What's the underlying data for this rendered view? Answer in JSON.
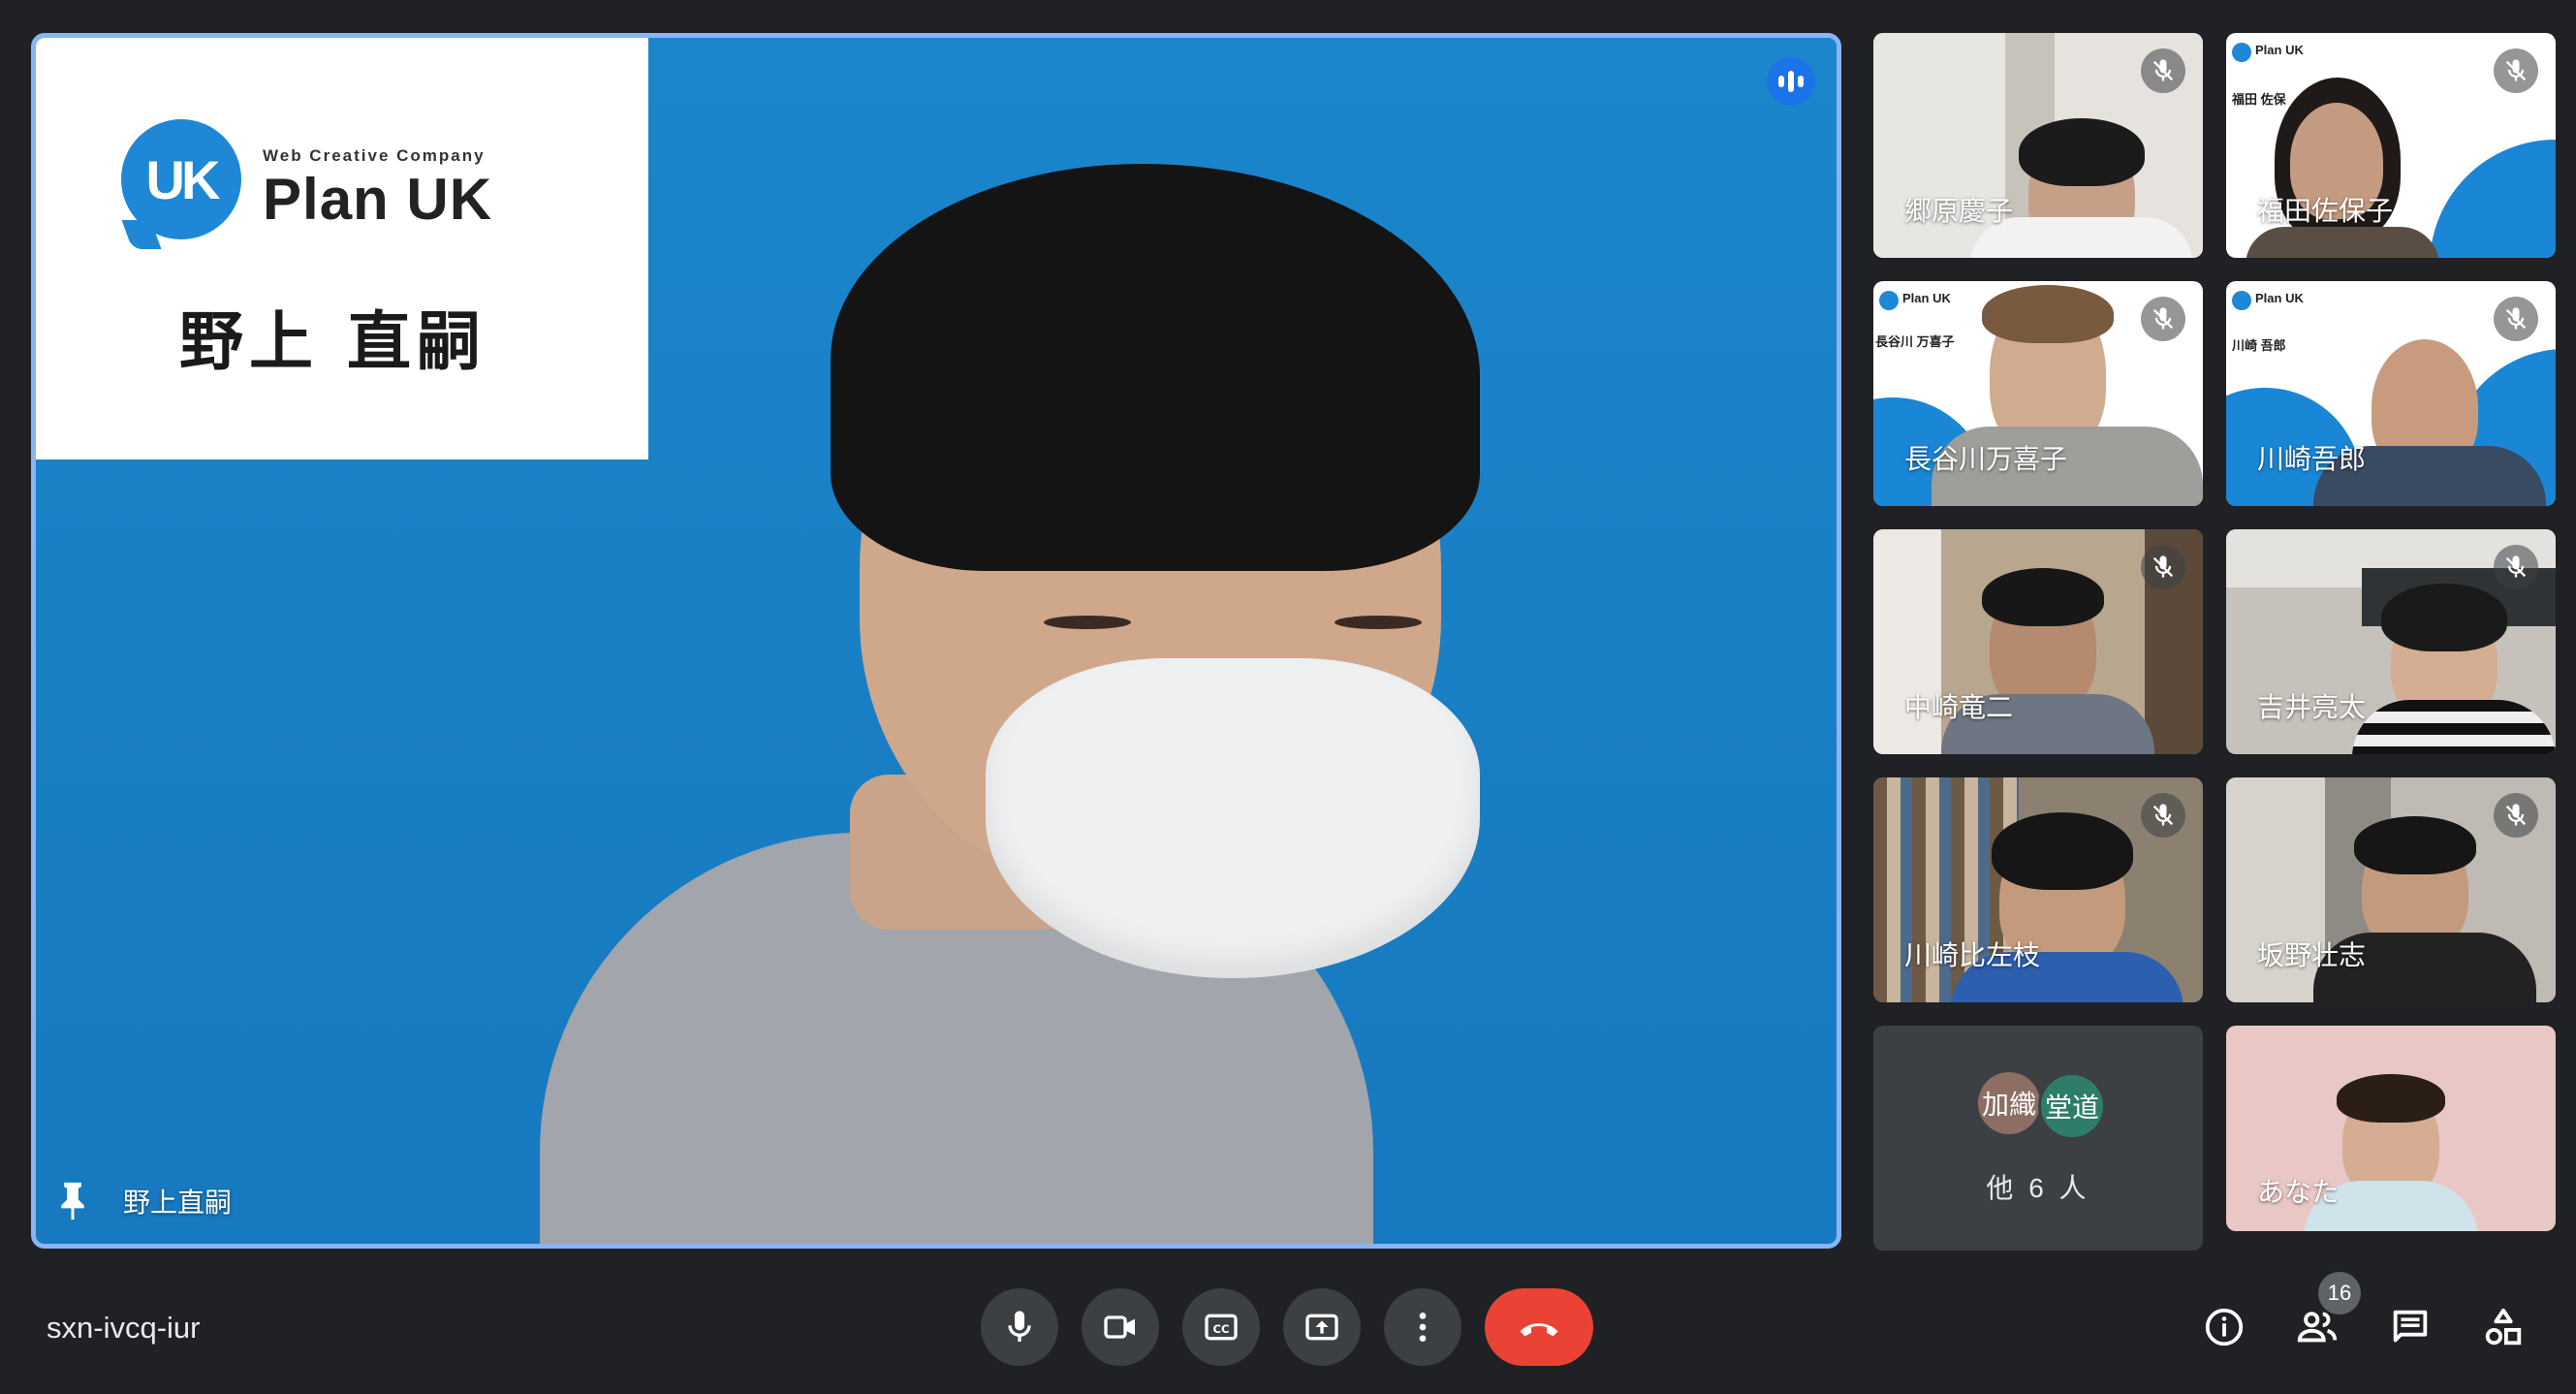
{
  "meeting": {
    "code": "sxn-ivcq-iur"
  },
  "main_speaker": {
    "name": "野上直嗣",
    "card": {
      "tagline": "Web Creative Company",
      "brand": "Plan UK",
      "logo_letters": "UK",
      "person": "野上 直嗣"
    }
  },
  "participants": [
    {
      "name": "郷原慶子",
      "muted": true
    },
    {
      "name": "福田佐保子",
      "muted": true,
      "card_name": "福田 佐保"
    },
    {
      "name": "長谷川万喜子",
      "muted": true,
      "card_name": "長谷川 万喜子"
    },
    {
      "name": "川崎吾郎",
      "muted": true,
      "card_name": "川崎 吾郎"
    },
    {
      "name": "中崎竜二",
      "muted": true
    },
    {
      "name": "吉井亮太",
      "muted": true
    },
    {
      "name": "川崎比左枝",
      "muted": true
    },
    {
      "name": "坂野壮志",
      "muted": true
    }
  ],
  "others": {
    "avatar1": "加織",
    "avatar2": "堂道",
    "label": "他 6 人"
  },
  "self": {
    "name": "あなた"
  },
  "people_count": "16",
  "icons": {
    "mic": "mic-icon",
    "camera": "camera-icon",
    "captions": "captions-icon",
    "present": "present-icon",
    "more": "more-vert-icon",
    "hangup": "call-end-icon",
    "info": "info-icon",
    "people": "people-icon",
    "chat": "chat-icon",
    "activities": "activities-icon"
  },
  "colors": {
    "accent": "#8ab4f8",
    "hangup": "#ea4335",
    "bar_bg": "#202124",
    "button_bg": "#3c4043"
  }
}
